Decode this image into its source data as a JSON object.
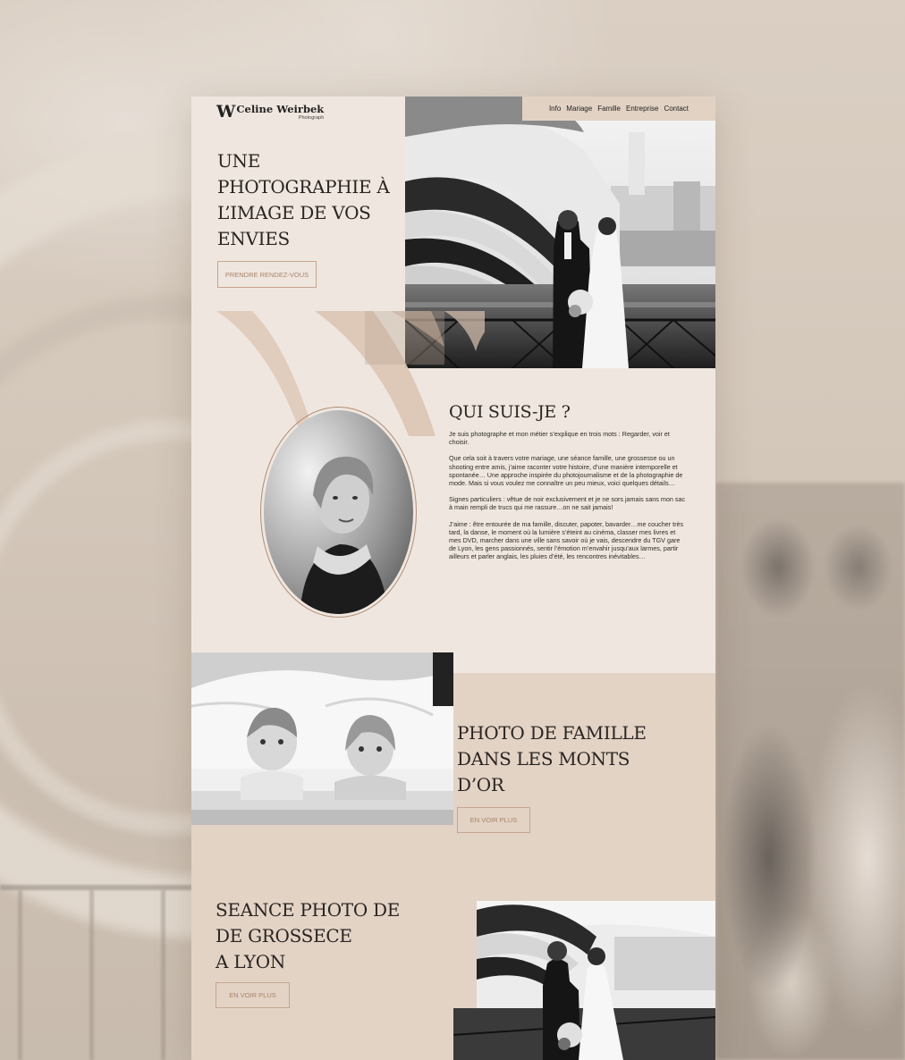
{
  "brand": {
    "mark": "W",
    "name": "Celine Weirbek",
    "subtitle": "Photograph"
  },
  "nav": {
    "items": [
      "Info",
      "Mariage",
      "Famille",
      "Entreprise",
      "Contact"
    ]
  },
  "hero": {
    "title_lines": [
      "UNE",
      "PHOTOGRAPHIE À",
      "L’IMAGE DE VOS",
      "ENVIES"
    ],
    "cta": "PRENDRE RENDEZ-VOUS",
    "photo_icon": "wedding-couple-bridge-photo"
  },
  "about": {
    "title": "QUI SUIS-JE ?",
    "paragraphs": [
      "Je suis photographe et mon métier s’explique en trois mots : Regarder, voir et choisir.",
      "Que cela soit à travers votre mariage, une séance famille, une grossesse ou un shooting entre amis, j’aime raconter votre histoire, d’une manière intemporelle et spontanée… Une approche inspirée du photojournalisme et de la photographie de mode. Mais si vous voulez me connaître un peu mieux, voici quelques détails…",
      "Signes particuliers : vêtue de noir exclusivement et je ne sors jamais sans mon sac à main rempli de trucs qui me rassure…on ne sait jamais!",
      "J’aime : être entourée de ma famille, discuter, papoter, bavarder…me coucher très tard, la danse, le moment où la lumière s’éteint au cinéma, classer mes livres et mes DVD, marcher dans une ville sans savoir où je vais, descendre du TGV gare de Lyon, les gens passionnés, sentir l’émotion m’envahir jusqu’aux larmes, partir ailleurs et parler anglais, les pluies d’été, les rencontres inévitables…"
    ],
    "portrait_icon": "portrait-photo"
  },
  "family": {
    "title_lines": [
      "PHOTO DE FAMILLE",
      "DANS LES MONTS",
      "D’OR"
    ],
    "cta": "EN VOIR PLUS",
    "photo_icon": "children-under-blanket-photo"
  },
  "pregnancy": {
    "title_lines": [
      "SEANCE PHOTO DE",
      "DE GROSSECE",
      "A LYON"
    ],
    "cta": "EN VOIR PLUS",
    "photo_icon": "wedding-couple-photo"
  },
  "colors": {
    "page_bg": "#efe7df",
    "band_bg": "#e3d3c5",
    "nav_bg": "#e2d2c4",
    "accent": "#c7a58e",
    "text": "#2a2522"
  }
}
